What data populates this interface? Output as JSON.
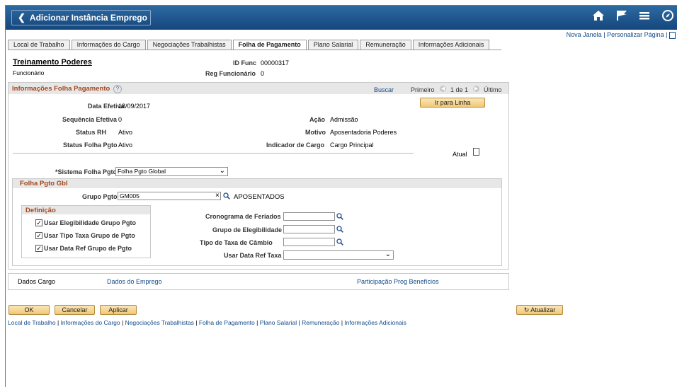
{
  "header": {
    "back_label": "Adicionar Instância Emprego"
  },
  "toplinks": {
    "new_window": "Nova Janela",
    "sep": "|",
    "personalize": "Personalizar Página",
    "sep2": "|"
  },
  "tabs": [
    {
      "label": "Local de Trabalho",
      "active": false
    },
    {
      "label": "Informações do Cargo",
      "active": false
    },
    {
      "label": "Negociações Trabalhistas",
      "active": false
    },
    {
      "label": "Folha de Pagamento",
      "active": true
    },
    {
      "label": "Plano Salarial",
      "active": false
    },
    {
      "label": "Remuneração",
      "active": false
    },
    {
      "label": "Informações Adicionais",
      "active": false
    }
  ],
  "employee": {
    "name": "Treinamento Poderes",
    "role": "Funcionário",
    "id_label": "ID Func",
    "id_value": "00000317",
    "reg_label": "Reg Funcionário",
    "reg_value": "0"
  },
  "payroll_info": {
    "title": "Informações Folha Pagamento",
    "help": "?",
    "search": "Buscar",
    "first": "Primeiro",
    "count": "1 de 1",
    "last": "Último",
    "goto_line": "Ir para Linha",
    "effective_date_label": "Data Efetiva",
    "effective_date": "18/09/2017",
    "eff_seq_label": "Sequência Efetiva",
    "eff_seq": "0",
    "action_label": "Ação",
    "action": "Admissão",
    "hr_status_label": "Status RH",
    "hr_status": "Ativo",
    "reason_label": "Motivo",
    "reason": "Aposentadoria Poderes",
    "payroll_status_label": "Status Folha Pgto",
    "payroll_status": "Ativo",
    "job_indicator_label": "Indicador de Cargo",
    "job_indicator": "Cargo Principal",
    "current_label": "Atual",
    "payroll_system_label": "*Sistema Folha Pgto",
    "payroll_system": "Folha Pgto Global"
  },
  "gp": {
    "title": "Folha Pgto Gbl",
    "pay_group_label": "Grupo Pgto",
    "pay_group": "GM005",
    "pay_group_clear": "×",
    "pay_group_desc": "APOSENTADOS",
    "definition_title": "Definição",
    "checks": [
      {
        "label": "Usar Elegibilidade Grupo Pgto",
        "checked": true
      },
      {
        "label": "Usar Tipo Taxa Grupo de Pgto",
        "checked": true
      },
      {
        "label": "Usar Data Ref Grupo de Pgto",
        "checked": true
      }
    ],
    "holiday_label": "Cronograma de Feriados",
    "elig_label": "Grupo de Elegibilidade",
    "rate_type_label": "Tipo de Taxa de Câmbio",
    "rate_date_label": "Usar Data Ref Taxa",
    "holiday": "",
    "elig": "",
    "rate_type": "",
    "rate_date": ""
  },
  "bottom_links": {
    "job_data": "Dados Cargo",
    "employment_data": "Dados do Emprego",
    "benefits": "Participação Prog Benefícios"
  },
  "buttons": {
    "ok": "OK",
    "cancel": "Cancelar",
    "apply": "Aplicar",
    "refresh": "Atualizar"
  },
  "footer_links": [
    "Local de Trabalho",
    "Informações do Cargo",
    "Negociações Trabalhistas",
    "Folha de Pagamento",
    "Plano Salarial",
    "Remuneração",
    "Informações Adicionais"
  ],
  "footer_sep": " | ",
  "icons": {
    "back": "chevron-left-icon",
    "home": "home-icon",
    "flag": "flag-icon",
    "menu": "hamburger-icon",
    "nav": "compass-icon",
    "search": "magnifier-icon",
    "refresh": "refresh-icon"
  },
  "colors": {
    "header_top": "#2d6aa2",
    "header_bottom": "#15467c",
    "link": "#124b8a",
    "section_title": "#a2471c",
    "button": "#f0c878"
  }
}
